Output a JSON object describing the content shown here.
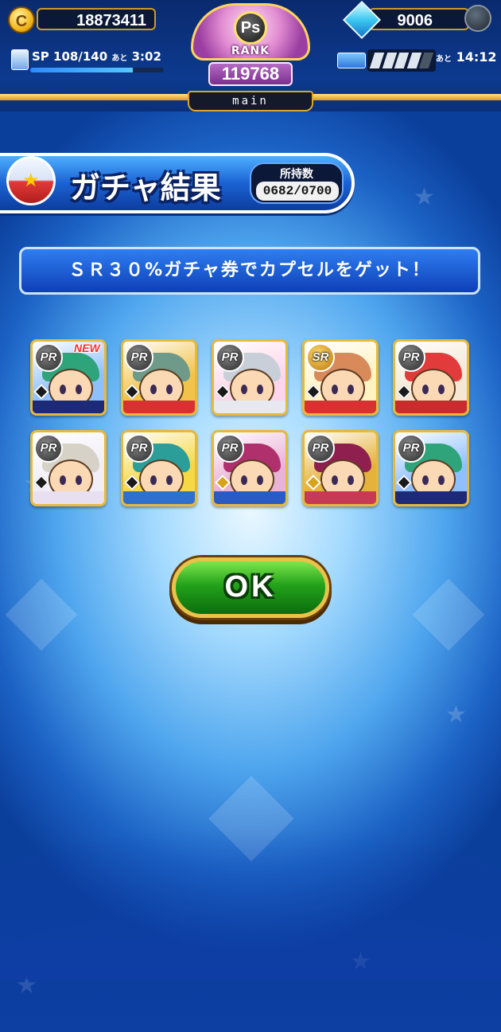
{
  "hud": {
    "coins": "18873411",
    "coin_icon_glyph": "C",
    "gems": "9006",
    "sp_label": "SP",
    "sp_current": "108",
    "sp_max": "140",
    "sp_fill_fraction": 0.77,
    "sp_ato": "あと",
    "sp_timer": "3:02",
    "stamina_ato": "あと",
    "stamina_timer": "14:12",
    "stamina_segments_filled": 4,
    "stamina_segments_total": 5,
    "rank_badge": "Ps",
    "rank_label": "RANK",
    "rank_value": "119768",
    "deck_name": "main"
  },
  "header": {
    "title": "ガチャ結果",
    "owned_label": "所持数",
    "owned_value": "0682/0700"
  },
  "message": "ＳＲ３０%ガチャ券でカプセルをゲット！",
  "cards": [
    {
      "rarity": "PR",
      "is_new": true,
      "new_label": "NEW",
      "gem": "dark",
      "hair": "#2fa37a",
      "bg": "#8ec0ff",
      "strip": "#1d2a78"
    },
    {
      "rarity": "PR",
      "is_new": false,
      "gem": "dark",
      "hair": "#6f9a8a",
      "bg": "#f2c34b",
      "strip": "#d93131"
    },
    {
      "rarity": "PR",
      "is_new": false,
      "gem": "dark",
      "hair": "#c9cfd8",
      "bg": "#ffd6e9",
      "strip": "#e6e9f0"
    },
    {
      "rarity": "SR",
      "is_new": false,
      "gem": "dark",
      "hair": "#d98a5a",
      "bg": "#fff3c2",
      "strip": "#d93131"
    },
    {
      "rarity": "PR",
      "is_new": false,
      "gem": "dark",
      "hair": "#e23b3b",
      "bg": "#f5e7d2",
      "strip": "#c92c2c"
    },
    {
      "rarity": "PR",
      "is_new": false,
      "gem": "dark",
      "hair": "#d7d2c7",
      "bg": "#f1eef7",
      "strip": "#e8e0f0"
    },
    {
      "rarity": "PR",
      "is_new": false,
      "gem": "dark",
      "hair": "#2b9e9a",
      "bg": "#f4d846",
      "strip": "#2f6fd0"
    },
    {
      "rarity": "PR",
      "is_new": false,
      "gem": "gold",
      "hair": "#b0306e",
      "bg": "#e9b3d5",
      "strip": "#2a5bc4"
    },
    {
      "rarity": "PR",
      "is_new": false,
      "gem": "gold",
      "hair": "#8e1f4e",
      "bg": "#e5b23b",
      "strip": "#c73a55"
    },
    {
      "rarity": "PR",
      "is_new": false,
      "gem": "dark",
      "hair": "#2fa37a",
      "bg": "#8ec0ff",
      "strip": "#1d2a78"
    }
  ],
  "ok_button": "OK",
  "colors": {
    "accent_gold": "#e7b93a",
    "ok_green": "#23a21a",
    "banner_blue": "#1b62d4"
  }
}
